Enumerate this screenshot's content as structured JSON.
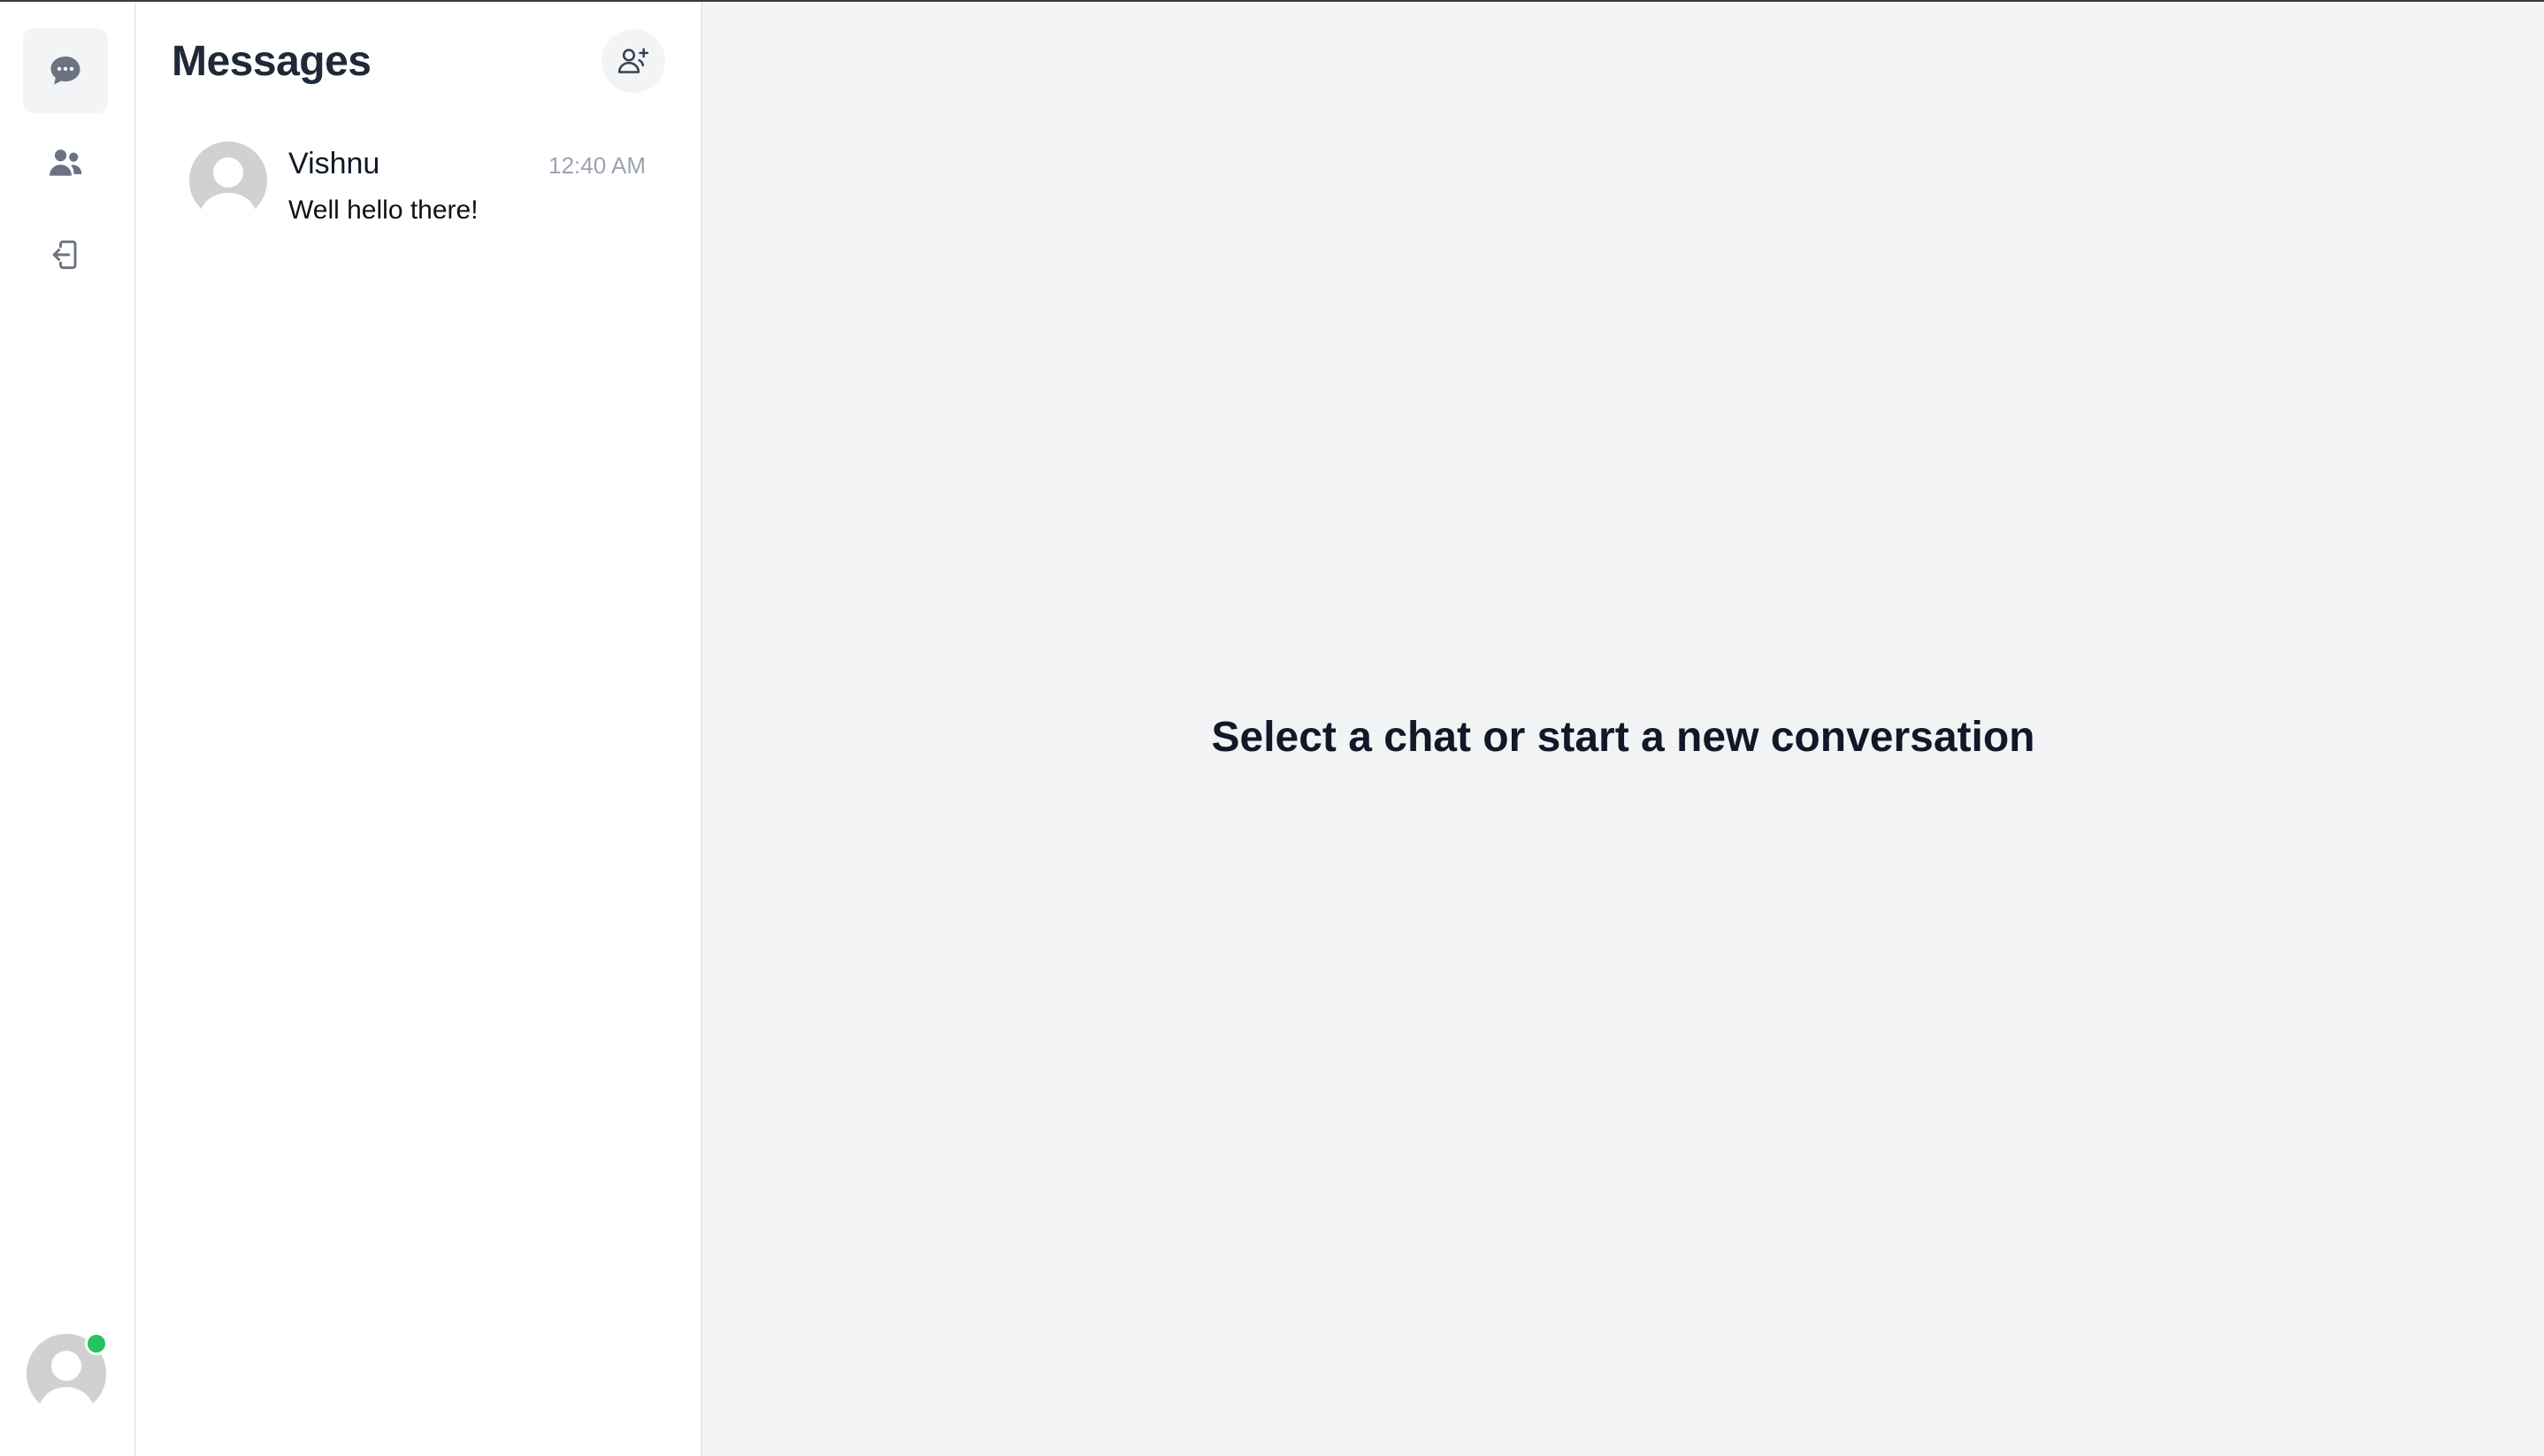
{
  "rail": {
    "items": [
      {
        "icon": "chat-bubble-icon",
        "active": true
      },
      {
        "icon": "users-icon",
        "active": false
      },
      {
        "icon": "logout-icon",
        "active": false
      }
    ],
    "user_status": "online"
  },
  "list": {
    "title": "Messages",
    "new_chat_icon": "user-plus-icon",
    "conversations": [
      {
        "name": "Vishnu",
        "time": "12:40 AM",
        "preview": "Well hello there!"
      }
    ]
  },
  "main": {
    "empty_message": "Select a chat or start a new conversation"
  },
  "colors": {
    "online": "#22c55e",
    "active_bg": "#f3f4f6",
    "main_bg": "#f2f3f5"
  }
}
